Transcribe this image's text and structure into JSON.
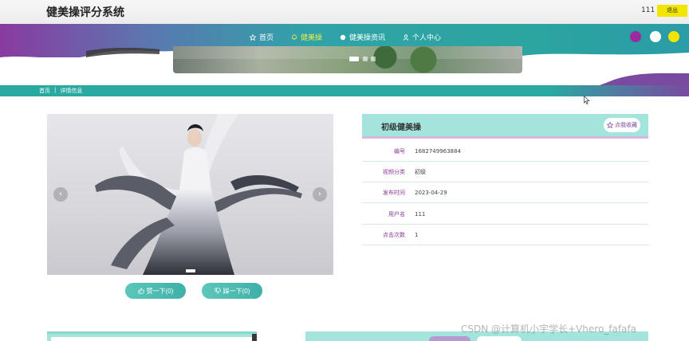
{
  "header": {
    "site_title": "健美操评分系统",
    "user_name": "111",
    "logout_label": "退出"
  },
  "nav": {
    "items": [
      {
        "label": "首页",
        "icon": "star-icon",
        "active": false
      },
      {
        "label": "健美操",
        "icon": "bell-icon",
        "active": true
      },
      {
        "label": "健美操资讯",
        "icon": "circle-icon",
        "active": false
      },
      {
        "label": "个人中心",
        "icon": "user-icon",
        "active": false
      }
    ],
    "active_color": "#f4ea4a"
  },
  "breadcrumb": {
    "home": "首页",
    "separator": "|",
    "current": "详情信息"
  },
  "gallery": {
    "prev_glyph": "‹",
    "next_glyph": "›"
  },
  "actions": {
    "like_label": "赞一下(0)",
    "dislike_label": "踩一下(0)"
  },
  "detail": {
    "title": "初级健美操",
    "favorite_label": "点我收藏",
    "rows": [
      {
        "label": "编号",
        "value": "1682749963884"
      },
      {
        "label": "视频分类",
        "value": "初级"
      },
      {
        "label": "发布时间",
        "value": "2023-04-29"
      },
      {
        "label": "用户名",
        "value": "111"
      },
      {
        "label": "点击次数",
        "value": "1"
      }
    ]
  },
  "watermark": "CSDN @计算机小宇学长+Vhero_fafafa",
  "colors": {
    "teal": "#2aa8a2",
    "purple": "#8a3aa0",
    "yellow": "#f2e600",
    "panel": "#a3e4dc"
  }
}
